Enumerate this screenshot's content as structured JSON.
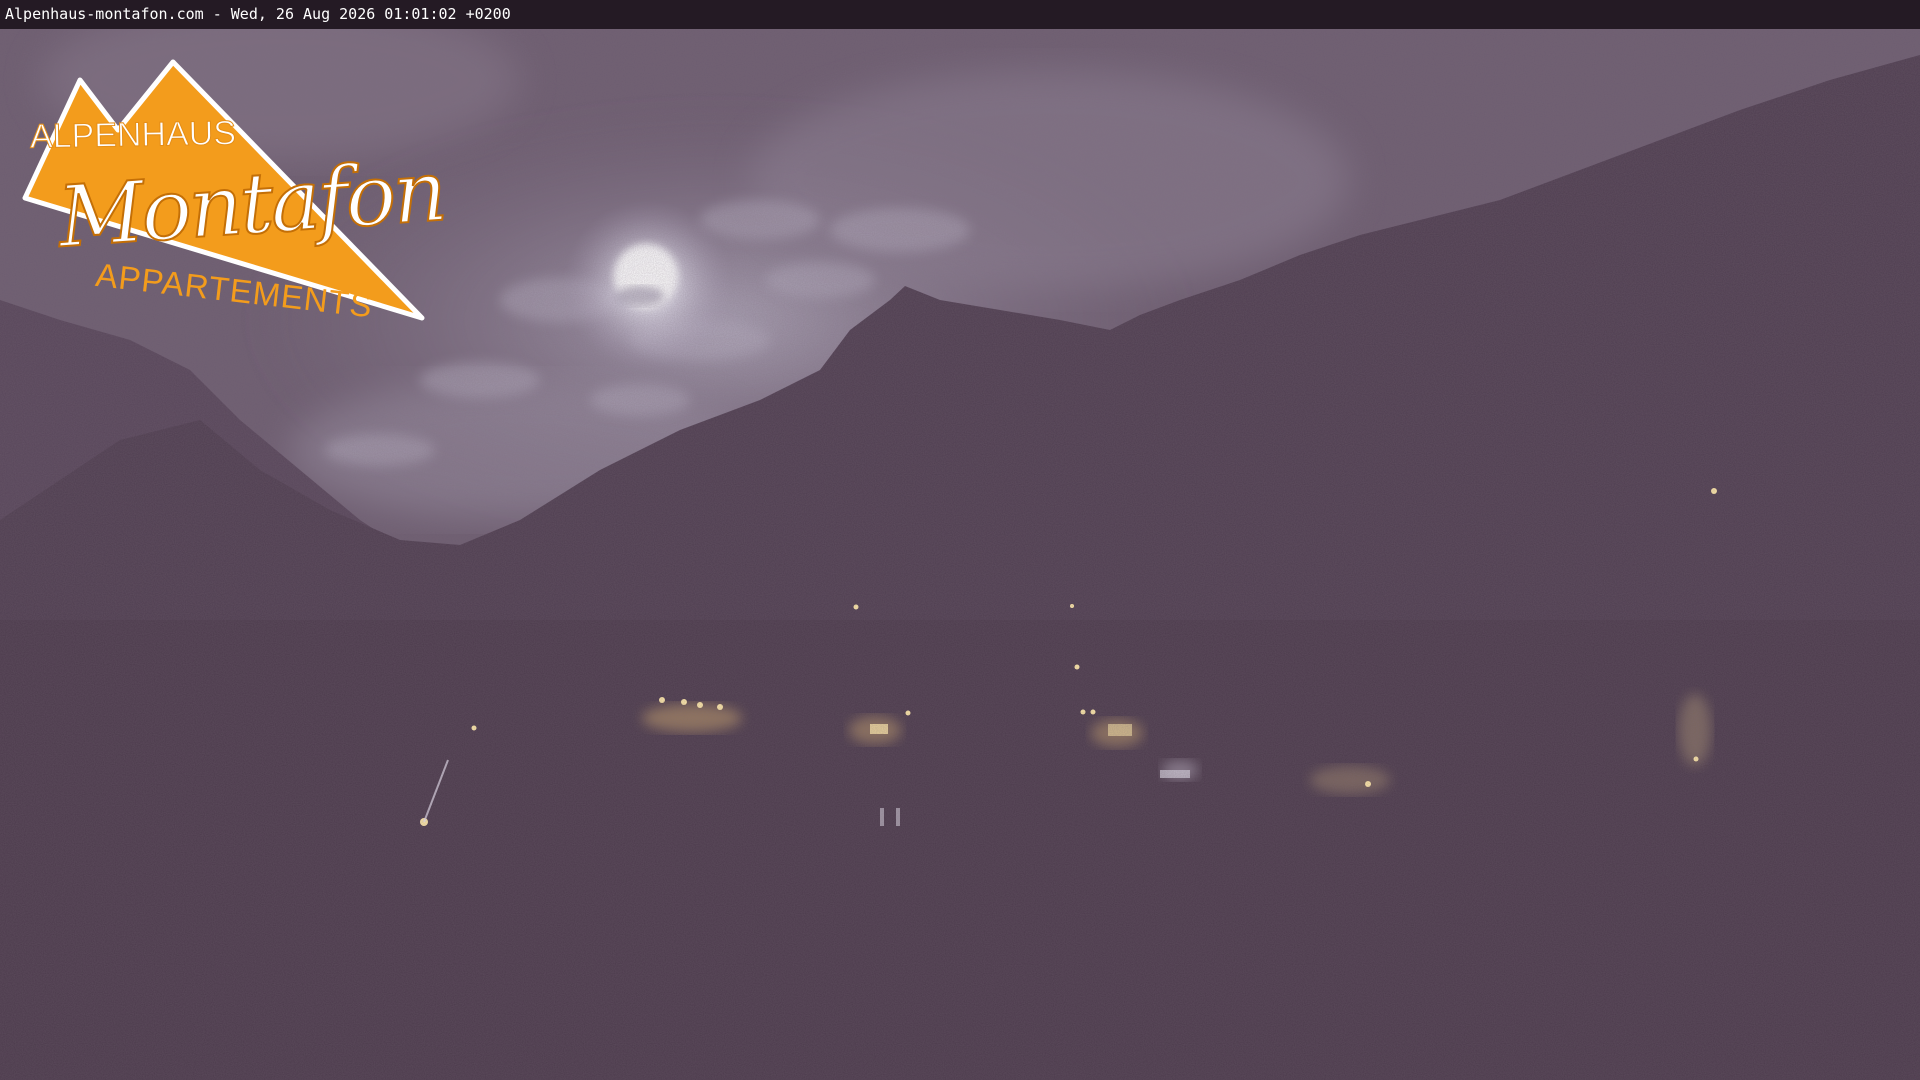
{
  "stamp": {
    "text": "Alpenhaus-montafon.com - Wed, 26 Aug 2026 01:01:02 +0200"
  },
  "logo": {
    "brand": "ALPENHAUS",
    "name": "Montafon",
    "subtitle": "APPARTEMENTS",
    "accent_color": "#f39c1c"
  },
  "scene": {
    "sky_color": "#6b5a6e",
    "mountain_color": "#4c3b4b",
    "light_color": "#ffe9a8"
  }
}
